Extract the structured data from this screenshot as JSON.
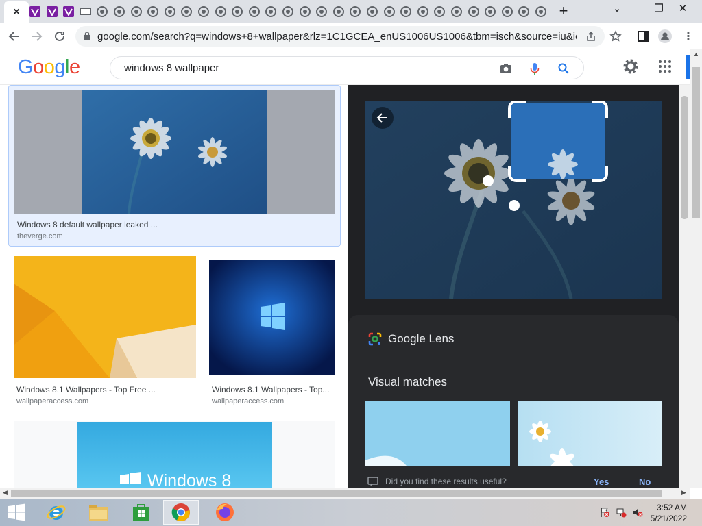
{
  "browser": {
    "tabs": [
      {
        "type": "close",
        "label": "×",
        "active": true
      },
      {
        "type": "vivaldi"
      },
      {
        "type": "vivaldi"
      },
      {
        "type": "vivaldi"
      },
      {
        "type": "window"
      },
      {
        "type": "globe"
      },
      {
        "type": "globe"
      },
      {
        "type": "globe"
      },
      {
        "type": "globe"
      },
      {
        "type": "globe"
      },
      {
        "type": "globe"
      },
      {
        "type": "globe"
      },
      {
        "type": "globe"
      },
      {
        "type": "globe"
      },
      {
        "type": "globe"
      },
      {
        "type": "globe"
      },
      {
        "type": "globe"
      },
      {
        "type": "globe"
      },
      {
        "type": "globe"
      },
      {
        "type": "globe"
      },
      {
        "type": "globe"
      },
      {
        "type": "globe"
      },
      {
        "type": "globe"
      },
      {
        "type": "globe"
      },
      {
        "type": "globe"
      },
      {
        "type": "globe"
      },
      {
        "type": "globe"
      },
      {
        "type": "globe"
      },
      {
        "type": "globe"
      },
      {
        "type": "globe"
      },
      {
        "type": "globe"
      },
      {
        "type": "globe"
      }
    ],
    "new_tab_label": "+",
    "window_controls": {
      "dropdown": "⌄",
      "restore": "❐",
      "close": "✕"
    },
    "url": "google.com/search?q=windows+8+wallpaper&rlz=1C1GCEA_enUS1006US1006&tbm=isch&source=iu&ictx=1&..."
  },
  "google": {
    "logo_letters": [
      {
        "ch": "G",
        "color": "#4285F4"
      },
      {
        "ch": "o",
        "color": "#EA4335"
      },
      {
        "ch": "o",
        "color": "#FBBC05"
      },
      {
        "ch": "g",
        "color": "#4285F4"
      },
      {
        "ch": "l",
        "color": "#34A853"
      },
      {
        "ch": "e",
        "color": "#EA4335"
      }
    ],
    "query": "windows 8 wallpaper"
  },
  "results": [
    {
      "title": "Windows 8 default wallpaper leaked ...",
      "source": "theverge.com"
    },
    {
      "title": "Windows 8.1 Wallpapers - Top Free ...",
      "source": "wallpaperaccess.com"
    },
    {
      "title": "Windows 8.1 Wallpapers - Top...",
      "source": "wallpaperaccess.com"
    },
    {
      "title": "",
      "source": "",
      "overlay": "Windows 8"
    }
  ],
  "lens": {
    "label": "Google Lens",
    "visual_matches_title": "Visual matches",
    "feedback_question": "Did you find these results useful?",
    "feedback_yes": "Yes",
    "feedback_no": "No"
  },
  "taskbar": {
    "apps": [
      "windows-start",
      "internet-explorer",
      "file-explorer",
      "store",
      "chrome",
      "firefox"
    ],
    "time": "3:52 AM",
    "date": "5/21/2022"
  }
}
